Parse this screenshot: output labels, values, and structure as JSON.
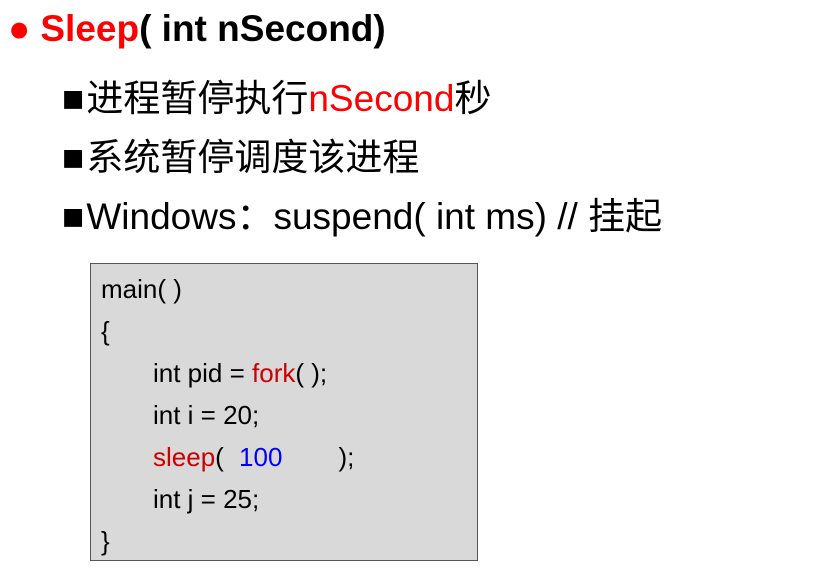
{
  "heading": {
    "bullet": "●",
    "func": "Sleep",
    "rest": "( int nSecond)"
  },
  "points": [
    {
      "bullet": "■",
      "pre": "进程暂停执行",
      "highlight": "nSecond",
      "post": "秒"
    },
    {
      "bullet": "■",
      "text": "系统暂停调度该进程"
    },
    {
      "bullet": "■",
      "text": "Windows：suspend( int ms)  // 挂起"
    }
  ],
  "code": {
    "line1": "main( )",
    "line2": "{",
    "line3_pre": "int pid = ",
    "line3_func": "fork",
    "line3_post": "( );",
    "line4": "int i = 20;",
    "line5_func": "sleep",
    "line5_paren": "( ",
    "line5_num": "100",
    "line5_end": ");",
    "line6": "int j = 25;",
    "line7": "}"
  }
}
